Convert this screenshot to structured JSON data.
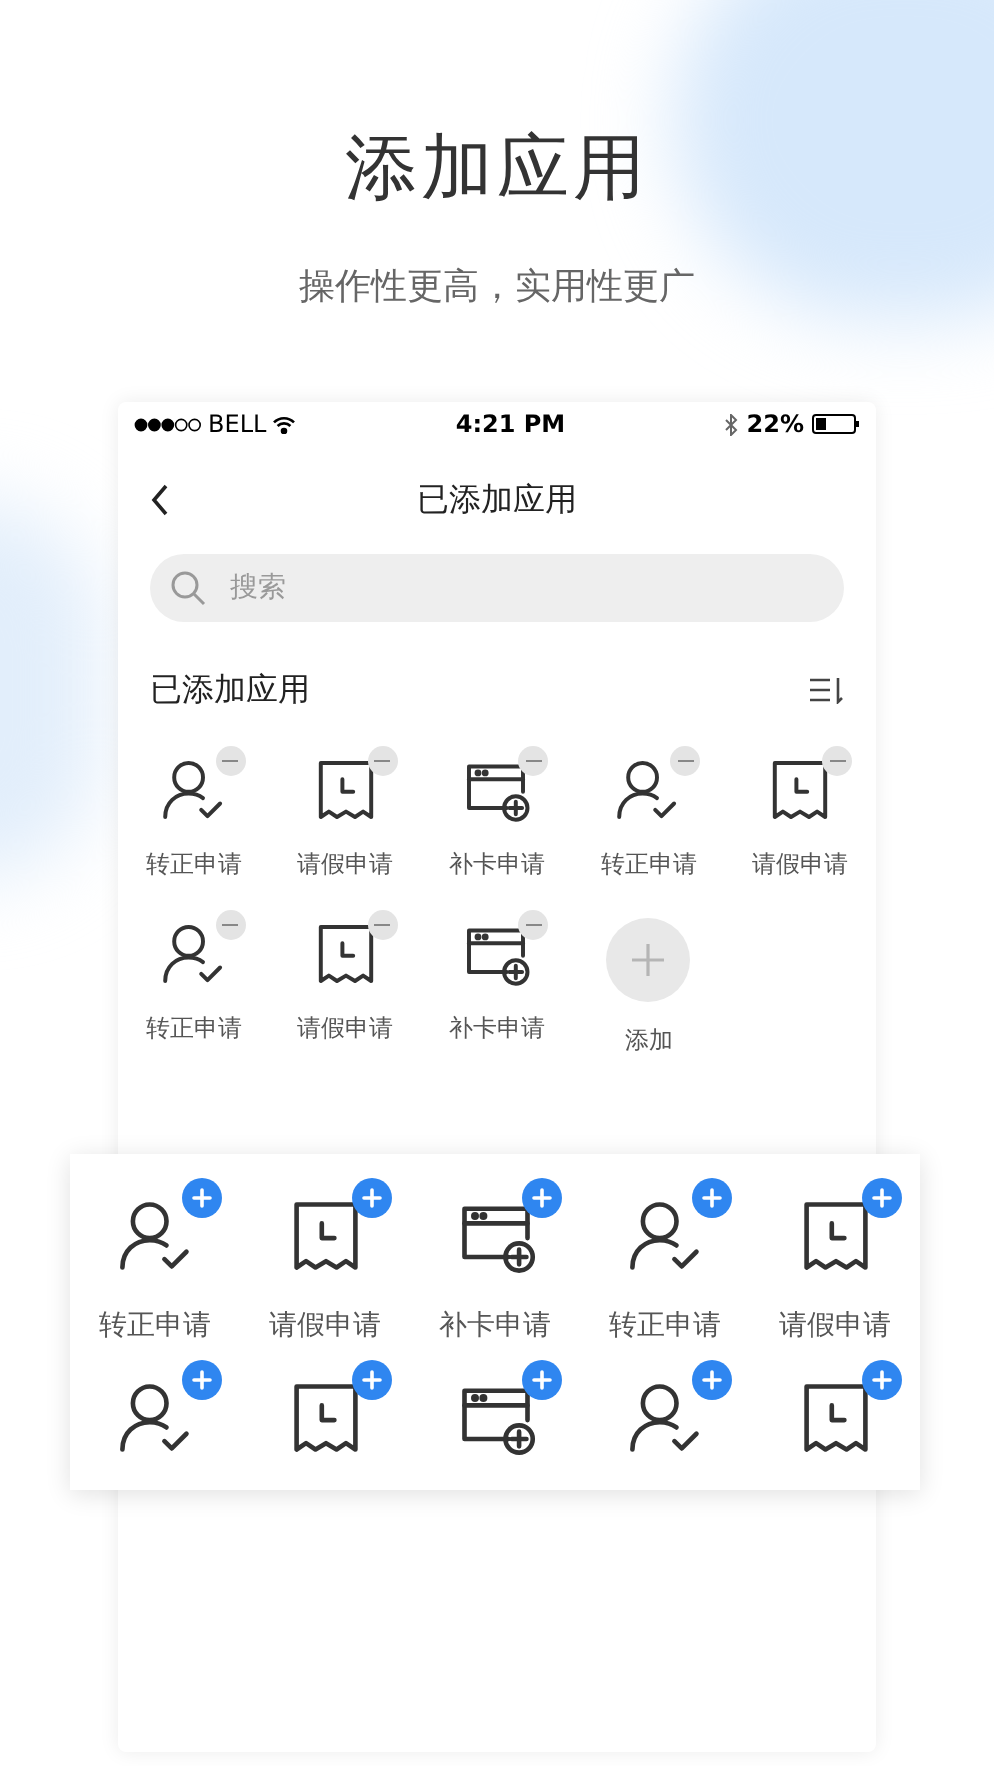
{
  "headline": "添加应用",
  "subtitle": "操作性更高，实用性更广",
  "phone": {
    "status_bar": {
      "carrier": "BELL",
      "time": "4:21 PM",
      "battery": "22%"
    },
    "nav_title": "已添加应用",
    "search": {
      "placeholder": "搜索"
    },
    "section_title": "已添加应用",
    "added_apps": {
      "kind": "remove",
      "items": [
        {
          "kind": "user",
          "label": "转正申请"
        },
        {
          "kind": "leave",
          "label": "请假申请"
        },
        {
          "kind": "card",
          "label": "补卡申请"
        },
        {
          "kind": "user",
          "label": "转正申请"
        },
        {
          "kind": "leave",
          "label": "请假申请"
        },
        {
          "kind": "user",
          "label": "转正申请"
        },
        {
          "kind": "leave",
          "label": "请假申请"
        },
        {
          "kind": "card",
          "label": "补卡申请"
        },
        {
          "kind": "add",
          "label": "添加"
        }
      ]
    }
  },
  "available_apps": {
    "kind": "add",
    "items": [
      {
        "kind": "user",
        "label": "转正申请"
      },
      {
        "kind": "leave",
        "label": "请假申请"
      },
      {
        "kind": "card",
        "label": "补卡申请"
      },
      {
        "kind": "user",
        "label": "转正申请"
      },
      {
        "kind": "leave",
        "label": "请假申请"
      },
      {
        "kind": "user"
      },
      {
        "kind": "leave"
      },
      {
        "kind": "card"
      },
      {
        "kind": "user"
      },
      {
        "kind": "leave"
      }
    ]
  }
}
